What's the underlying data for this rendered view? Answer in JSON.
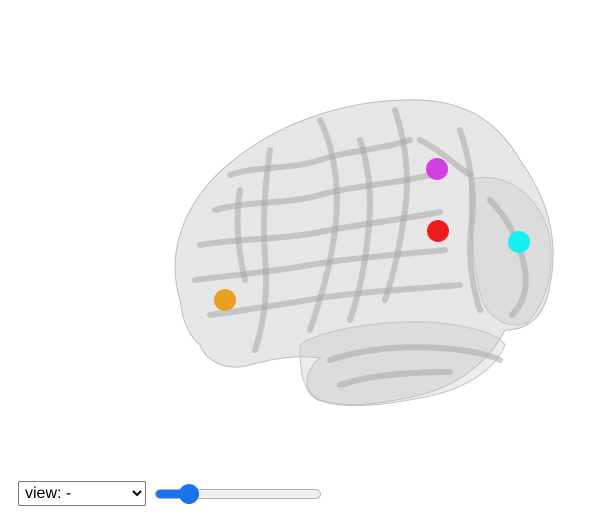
{
  "viewer": {
    "brain_color": "#c8c8c8",
    "markers": [
      {
        "name": "orange",
        "color": "#e8a020"
      },
      {
        "name": "magenta",
        "color": "#d23fe0"
      },
      {
        "name": "red",
        "color": "#ee1c1c"
      },
      {
        "name": "cyan",
        "color": "#14f0f0"
      }
    ]
  },
  "controls": {
    "view_select": {
      "selected": "view: -",
      "options": [
        "view: -"
      ]
    },
    "slider": {
      "value": 16,
      "min": 0,
      "max": 100,
      "accent": "#1a73e8"
    }
  }
}
